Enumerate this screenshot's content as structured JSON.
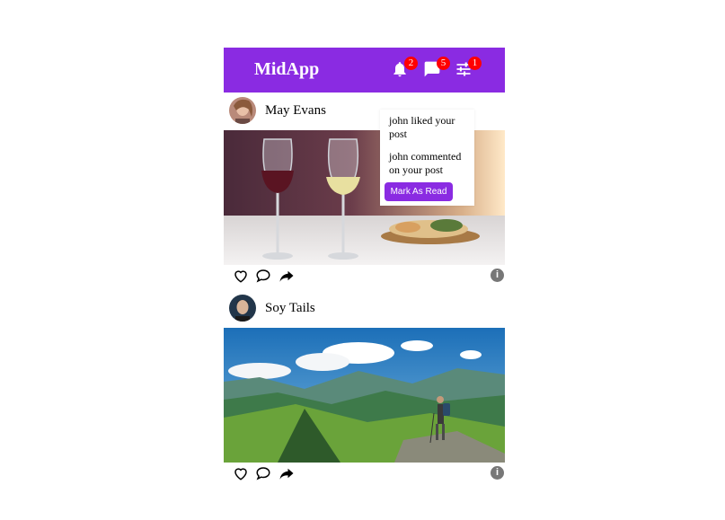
{
  "app": {
    "title": "MidApp",
    "accent": "#8a2be2",
    "badge_color": "#ff0000"
  },
  "navbar": {
    "notifications": {
      "icon": "bell-icon",
      "count": "2"
    },
    "messages": {
      "icon": "message-icon",
      "count": "5"
    },
    "settings": {
      "icon": "sliders-icon",
      "count": "1"
    }
  },
  "notifications": {
    "items": [
      "john liked your post",
      "john commented on your post"
    ],
    "mark_label": "Mark As Read"
  },
  "posts": [
    {
      "username": "May Evans",
      "image": "wine-glasses-photo"
    },
    {
      "username": "Soy Tails",
      "image": "mountain-hiker-photo"
    }
  ]
}
